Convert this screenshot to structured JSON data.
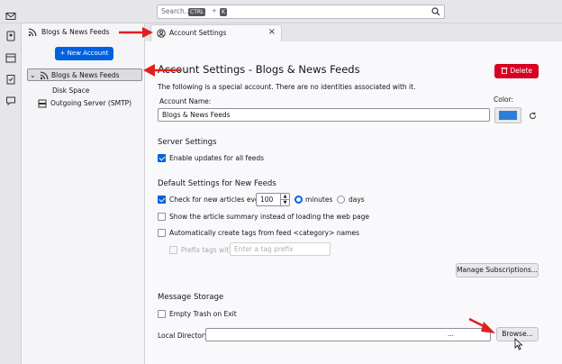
{
  "search": {
    "placeholder": "Search...",
    "key1": "CTRL",
    "plus": "+",
    "key2": "K"
  },
  "folder_pane": {
    "header": "Blogs & News Feeds",
    "new_account": "New Account",
    "tree": [
      {
        "label": "Blogs & News Feeds",
        "expanded": true,
        "selected": true
      },
      {
        "label": "Disk Space"
      },
      {
        "label": "Outgoing Server (SMTP)"
      }
    ]
  },
  "tab": {
    "label": "Account Settings",
    "close": "×"
  },
  "main": {
    "title": "Account Settings - Blogs & News Feeds",
    "delete_label": "Delete",
    "special_note": "The following is a special account. There are no identities associated with it.",
    "account_name_label": "Account Name:",
    "account_name_value": "Blogs & News Feeds",
    "color_label": "Color:",
    "color_value": "#2b7fd8",
    "server_settings": {
      "heading": "Server Settings",
      "enable_updates": "Enable updates for all feeds",
      "enable_updates_checked": true
    },
    "default_feeds": {
      "heading": "Default Settings for New Feeds",
      "check_for_new": "Check for new articles every",
      "check_checked": true,
      "interval": "100",
      "unit_minutes": "minutes",
      "unit_days": "days",
      "unit_selected": "minutes",
      "show_summary": "Show the article summary instead of loading the web page",
      "show_summary_checked": false,
      "auto_tags": "Automatically create tags from feed <category> names",
      "auto_tags_checked": false,
      "prefix_tags": "Prefix tags with:",
      "prefix_placeholder": "Enter a tag prefix",
      "manage_subscriptions": "Manage Subscriptions..."
    },
    "message_storage": {
      "heading": "Message Storage",
      "empty_trash": "Empty Trash on Exit",
      "empty_trash_checked": false,
      "local_directory_label": "Local Directory:",
      "local_directory_value": "...",
      "browse": "Browse..."
    }
  },
  "colors": {
    "accent": "#0061e0",
    "delete": "#d70022",
    "annotation_arrow": "#e02020"
  }
}
